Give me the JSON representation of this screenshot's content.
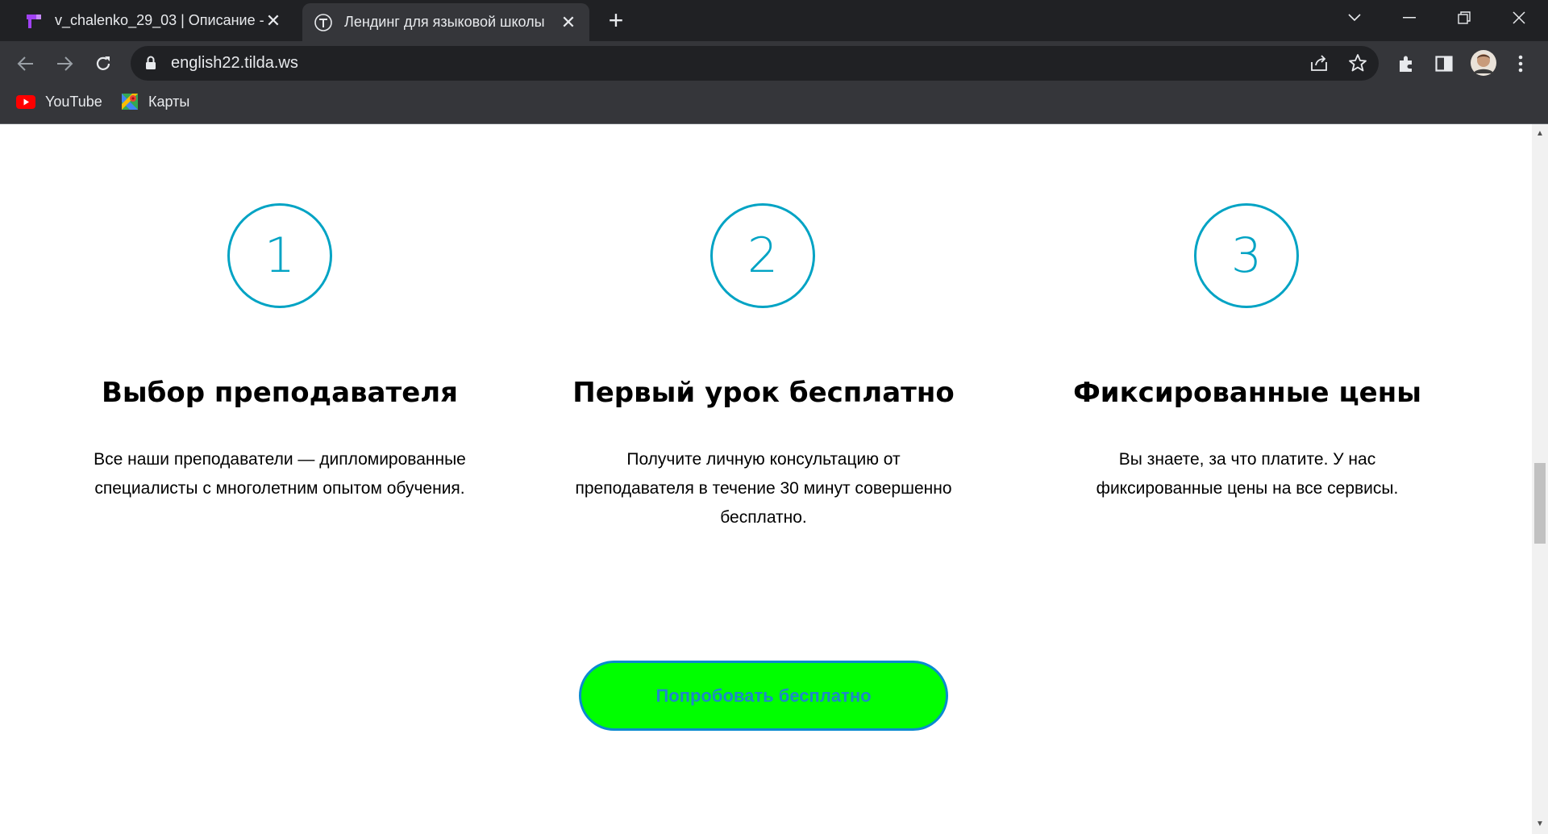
{
  "browser": {
    "tabs": [
      {
        "title": "v_chalenko_29_03 | Описание - (",
        "active": false,
        "icon": "tilda-purple-icon"
      },
      {
        "title": "Лендинг для языковой школы",
        "active": true,
        "icon": "tilda-t-icon"
      }
    ],
    "url": "english22.tilda.ws",
    "bookmarks": [
      {
        "label": "YouTube",
        "icon": "youtube-icon"
      },
      {
        "label": "Карты",
        "icon": "maps-icon"
      }
    ]
  },
  "features": [
    {
      "number": "1",
      "title": "Выбор преподавателя",
      "text_lines": [
        "Все наши преподаватели — дипломированные",
        "специалисты с многолетним опытом обучения."
      ]
    },
    {
      "number": "2",
      "title": "Первый урок бесплатно",
      "text_lines": [
        "Получите личную консультацию от",
        "преподавателя в течение 30 минут совершенно",
        "бесплатно."
      ]
    },
    {
      "number": "3",
      "title": "Фиксированные цены",
      "text_lines": [
        "Вы знаете, за что платите. У нас",
        "фиксированные цены на все сервисы."
      ]
    }
  ],
  "cta": {
    "label": "Попробовать бесплатно"
  },
  "colors": {
    "accent": "#00a3c4",
    "cta_bg": "#00ff00",
    "cta_text": "#1e88c8"
  }
}
